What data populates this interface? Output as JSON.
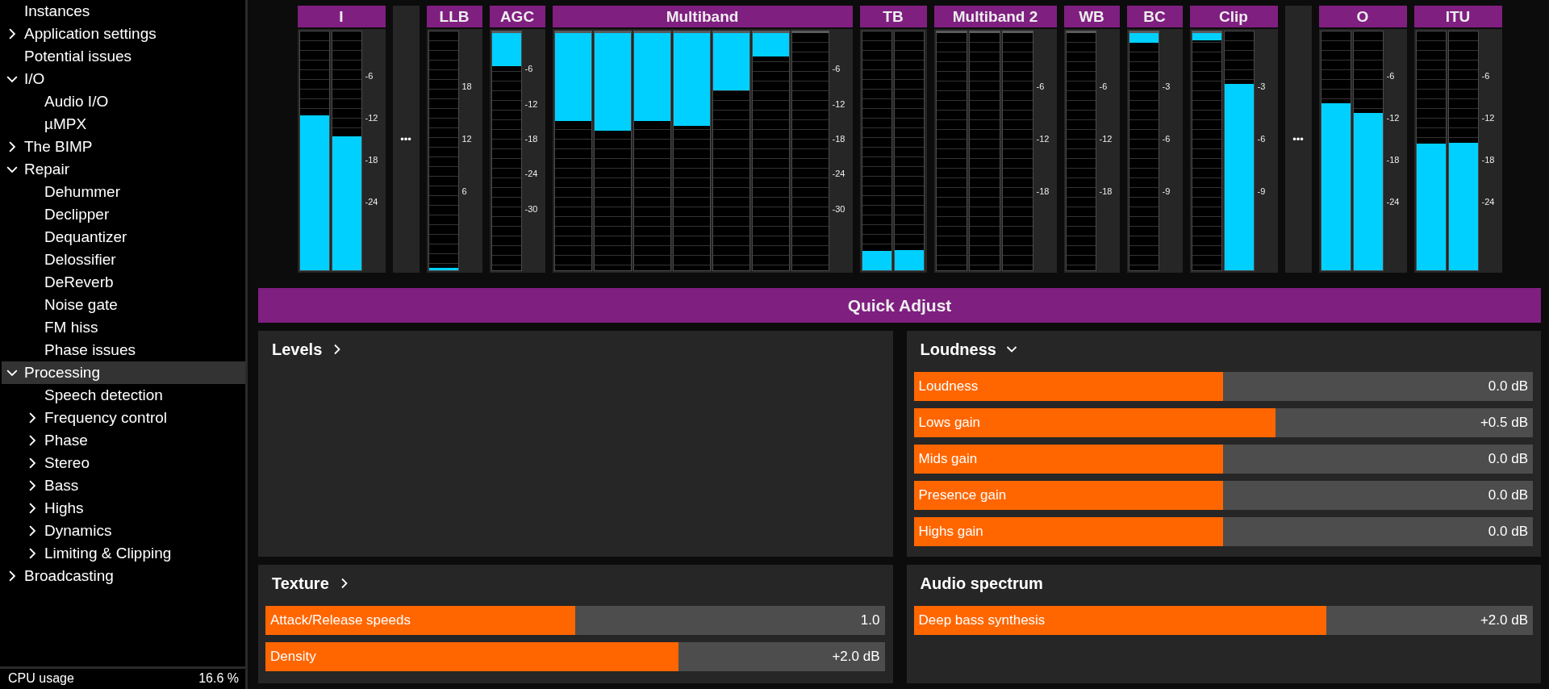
{
  "sidebar": {
    "items": [
      {
        "label": "Instances",
        "selected": false
      },
      {
        "label": "Application settings",
        "selected": false,
        "expanded": false
      },
      {
        "label": "Potential issues",
        "selected": false
      },
      {
        "label": "I/O",
        "selected": false,
        "expanded": true,
        "children": [
          {
            "label": "Audio I/O",
            "selected": false
          },
          {
            "label": "µMPX",
            "selected": false
          }
        ]
      },
      {
        "label": "The BIMP",
        "selected": false,
        "expanded": false
      },
      {
        "label": "Repair",
        "selected": false,
        "expanded": true,
        "children": [
          {
            "label": "Dehummer",
            "selected": false
          },
          {
            "label": "Declipper",
            "selected": false
          },
          {
            "label": "Dequantizer",
            "selected": false
          },
          {
            "label": "Delossifier",
            "selected": false
          },
          {
            "label": "DeReverb",
            "selected": false
          },
          {
            "label": "Noise gate",
            "selected": false
          },
          {
            "label": "FM hiss",
            "selected": false
          },
          {
            "label": "Phase issues",
            "selected": false
          }
        ]
      },
      {
        "label": "Processing",
        "selected": true,
        "expanded": true,
        "children": [
          {
            "label": "Speech detection",
            "selected": false
          },
          {
            "label": "Frequency control",
            "selected": false,
            "expanded": false
          },
          {
            "label": "Phase",
            "selected": false,
            "expanded": false
          },
          {
            "label": "Stereo",
            "selected": false,
            "expanded": false
          },
          {
            "label": "Bass",
            "selected": false,
            "expanded": false
          },
          {
            "label": "Highs",
            "selected": false,
            "expanded": false
          },
          {
            "label": "Dynamics",
            "selected": false,
            "expanded": false
          },
          {
            "label": "Limiting & Clipping",
            "selected": false,
            "expanded": false
          }
        ]
      },
      {
        "label": "Broadcasting",
        "selected": false,
        "expanded": false
      }
    ],
    "status": {
      "label": "CPU usage",
      "value": "16.6 %"
    }
  },
  "meters": [
    {
      "kind": "meter",
      "title": "I",
      "bars": [
        {
          "kind": "level",
          "level": 0.65
        },
        {
          "kind": "level",
          "level": 0.56
        }
      ],
      "ticks": [
        "-6",
        "-12",
        "-18",
        "-24"
      ]
    },
    {
      "kind": "more",
      "label": "•••"
    },
    {
      "kind": "meter",
      "title": "LLB",
      "bars": [
        {
          "kind": "level",
          "level": 0.01
        }
      ],
      "ticks": [
        "18",
        "12",
        "6"
      ]
    },
    {
      "kind": "meter",
      "title": "AGC",
      "bars": [
        {
          "kind": "reduction",
          "level": 0.14
        }
      ],
      "ticks": [
        "-6",
        "-12",
        "-18",
        "-24",
        "-30"
      ]
    },
    {
      "kind": "meter",
      "title": "Multiband",
      "bars": [
        {
          "kind": "reduction",
          "level": 0.37
        },
        {
          "kind": "reduction",
          "level": 0.41
        },
        {
          "kind": "reduction",
          "level": 0.37
        },
        {
          "kind": "reduction",
          "level": 0.39
        },
        {
          "kind": "reduction",
          "level": 0.24
        },
        {
          "kind": "reduction",
          "level": 0.1
        },
        {
          "kind": "reduction"
        }
      ],
      "ticks": [
        "-6",
        "-12",
        "-18",
        "-24",
        "-30"
      ]
    },
    {
      "kind": "meter",
      "title": "TB",
      "bars": [
        {
          "kind": "level",
          "level": 0.08
        },
        {
          "kind": "level",
          "level": 0.085
        }
      ]
    },
    {
      "kind": "meter",
      "title": "Multiband 2",
      "bars": [
        {
          "kind": "reduction"
        },
        {
          "kind": "reduction"
        },
        {
          "kind": "reduction"
        }
      ],
      "ticks": [
        "-6",
        "-12",
        "-18"
      ]
    },
    {
      "kind": "meter",
      "title": "WB",
      "bars": [
        {
          "kind": "reduction"
        }
      ],
      "ticks": [
        "-6",
        "-12",
        "-18"
      ]
    },
    {
      "kind": "meter",
      "title": "BC",
      "bars": [
        {
          "kind": "reduction",
          "level": 0.04
        }
      ],
      "ticks": [
        "-3",
        "-6",
        "-9"
      ]
    },
    {
      "kind": "meter",
      "title": "Clip",
      "bars": [
        {
          "kind": "reduction",
          "level": 0.03
        },
        {
          "kind": "level",
          "level": 0.78
        }
      ],
      "ticks": [
        "-3",
        "-6",
        "-9"
      ]
    },
    {
      "kind": "more",
      "label": "•••"
    },
    {
      "kind": "meter",
      "title": "O",
      "bars": [
        {
          "kind": "level",
          "level": 0.7
        },
        {
          "kind": "level",
          "level": 0.66
        }
      ],
      "ticks": [
        "-6",
        "-12",
        "-18",
        "-24"
      ]
    },
    {
      "kind": "meter",
      "title": "ITU",
      "bars": [
        {
          "kind": "level",
          "level": 0.53
        },
        {
          "kind": "level",
          "level": 0.535
        }
      ],
      "ticks": [
        "-6",
        "-12",
        "-18",
        "-24"
      ]
    }
  ],
  "quick_adjust": {
    "title": "Quick Adjust",
    "panels": [
      {
        "title": "Levels",
        "expanded": false
      },
      {
        "title": "Loudness",
        "expanded": true,
        "sliders": [
          {
            "label": "Loudness",
            "reading": "0.0 dB",
            "level": 0.5
          },
          {
            "label": "Lows gain",
            "reading": "+0.5 dB",
            "level": 0.584
          },
          {
            "label": "Mids gain",
            "reading": "0.0 dB",
            "level": 0.5
          },
          {
            "label": "Presence gain",
            "reading": "0.0 dB",
            "level": 0.5
          },
          {
            "label": "Highs gain",
            "reading": "0.0 dB",
            "level": 0.5
          }
        ]
      },
      {
        "title": "Texture",
        "expanded": false,
        "sliders": [
          {
            "label": "Attack/Release speeds",
            "reading": "1.0",
            "level": 0.5
          },
          {
            "label": "Density",
            "reading": "+2.0 dB",
            "level": 0.667
          }
        ]
      },
      {
        "title": "Audio spectrum",
        "sliders": [
          {
            "label": "Deep bass synthesis",
            "reading": "+2.0 dB",
            "level": 0.667
          }
        ]
      }
    ]
  }
}
